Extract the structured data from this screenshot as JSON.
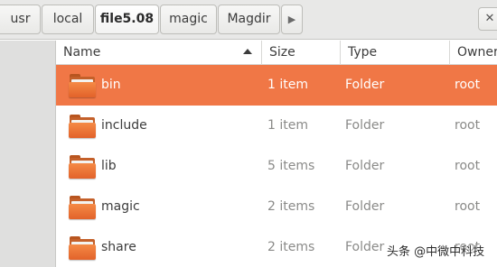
{
  "pathbar": {
    "crumbs": [
      {
        "label": "usr"
      },
      {
        "label": "local"
      },
      {
        "label": "file5.08"
      },
      {
        "label": "magic"
      },
      {
        "label": "Magdir"
      }
    ],
    "more_icon": "chevron-right-icon",
    "active_index": 2
  },
  "columns": {
    "name": "Name",
    "size": "Size",
    "type": "Type",
    "owner": "Owner",
    "sort_column": "name",
    "sort_direction": "ascending"
  },
  "files": [
    {
      "name": "bin",
      "size": "1 item",
      "type": "Folder",
      "owner": "root",
      "selected": true
    },
    {
      "name": "include",
      "size": "1 item",
      "type": "Folder",
      "owner": "root",
      "selected": false
    },
    {
      "name": "lib",
      "size": "5 items",
      "type": "Folder",
      "owner": "root",
      "selected": false
    },
    {
      "name": "magic",
      "size": "2 items",
      "type": "Folder",
      "owner": "root",
      "selected": false
    },
    {
      "name": "share",
      "size": "2 items",
      "type": "Folder",
      "owner": "root",
      "selected": false
    }
  ],
  "watermark": "头条 @中微中科技",
  "colors": {
    "selection": "#f07746",
    "folder": "#e9692c"
  }
}
